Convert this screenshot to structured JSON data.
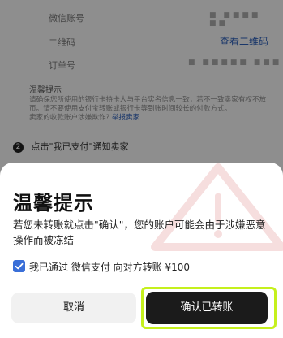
{
  "background": {
    "rows": [
      {
        "label": "微信账号",
        "value_masked": "■  ■■■■ ■■"
      },
      {
        "label": "二维码",
        "link": "查看二维码"
      },
      {
        "label": "订单号",
        "value_masked": "■ ■■■■■ ■■■"
      }
    ],
    "tip": {
      "title": "温馨提示",
      "lines": [
        "请确保您所使用的银行卡持卡人与平台实名信息一致，若不一致卖家有权不放",
        "币。请不要使用支付宝转账或银行卡等到账时间较长的付款方式。",
        "卖家的收款账户涉嫌欺诈?"
      ],
      "report": "举报卖家"
    },
    "step": {
      "num": "2",
      "text": "点击\"我已支付\"通知卖家"
    }
  },
  "modal": {
    "title": "温馨提示",
    "message": "若您未转账就点击\"确认\"，您的账户可能会由于涉嫌恶意操作而被冻结",
    "agree_text": "我已通过 微信支付 向对方转账 ¥100",
    "agree_checked": true,
    "cancel_label": "取消",
    "confirm_label": "确认已转账",
    "colors": {
      "accent": "#3a6fd8",
      "confirm_bg": "#1b1b1b",
      "highlight": "#c5f01d",
      "link": "#2e5fb7"
    }
  }
}
